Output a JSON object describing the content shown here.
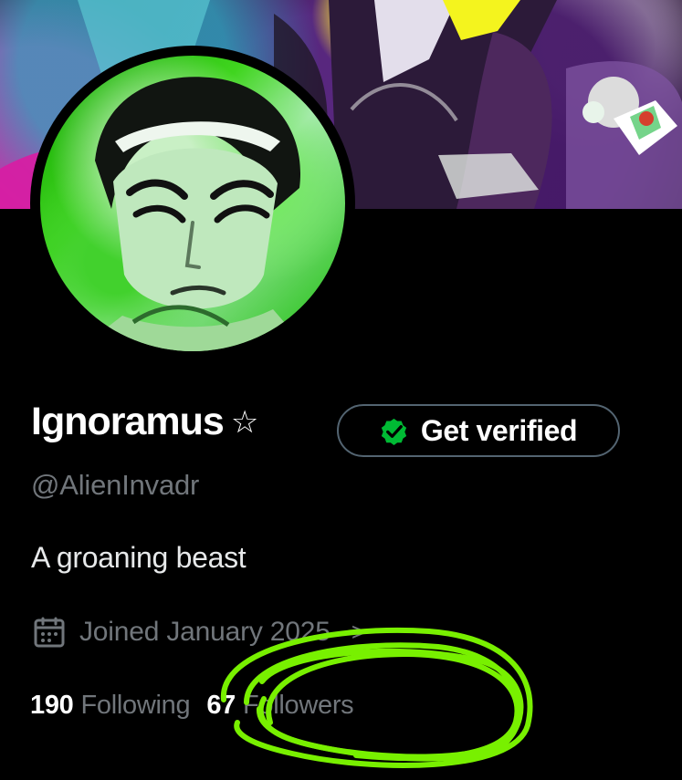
{
  "profile": {
    "display_name": "Ignoramus",
    "star": "☆",
    "handle": "@AlienInvadr",
    "bio": "A groaning beast",
    "joined": "Joined January 2025",
    "joined_chevron": ">"
  },
  "actions": {
    "verify_label": "Get verified"
  },
  "stats": {
    "following_count": "190",
    "following_label": "Following",
    "followers_count": "67",
    "followers_label": "Followers"
  },
  "colors": {
    "background": "#000000",
    "primary_text": "#e7e9ea",
    "secondary_text": "#71767b",
    "verified_green": "#00ba34",
    "annotation_green": "#78f000"
  },
  "icons": {
    "star": "star-outline-icon",
    "verified": "verified-badge-icon",
    "calendar": "calendar-icon"
  }
}
